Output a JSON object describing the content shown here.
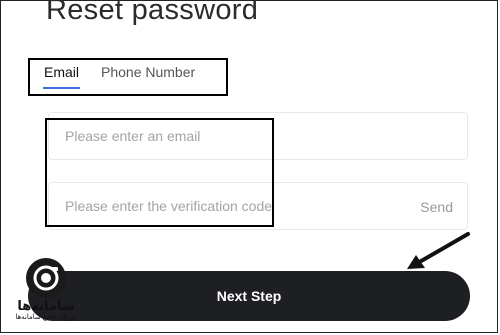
{
  "page": {
    "title": "Reset password"
  },
  "tabs": [
    {
      "label": "Email",
      "active": true
    },
    {
      "label": "Phone Number",
      "active": false
    }
  ],
  "form": {
    "email_placeholder": "Please enter an email",
    "code_placeholder": "Please enter the verification code",
    "send_label": "Send"
  },
  "actions": {
    "next_label": "Next Step"
  },
  "watermark": {
    "name": "سامانه‌ها",
    "tagline": "پورتال جامع سامانه‌ها"
  },
  "colors": {
    "accent": "#3e6fe0",
    "button_bg": "#1e1f23",
    "annotation": "#000000"
  }
}
